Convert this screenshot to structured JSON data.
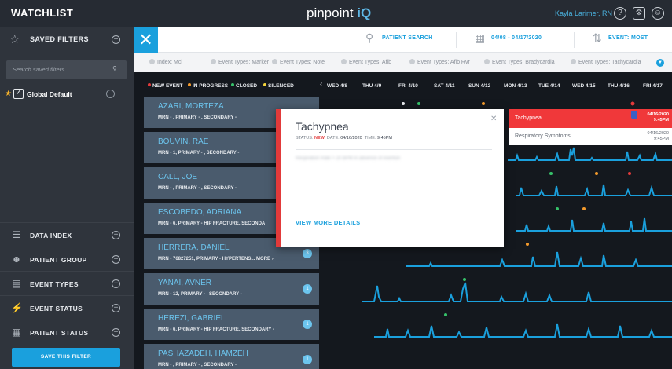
{
  "app": {
    "title": "WATCHLIST",
    "logo_text": "pinpoint",
    "logo_suffix": "iQ",
    "user_name": "Kayla Larimer, RN",
    "icons": [
      "help-icon",
      "settings-icon",
      "account-icon"
    ]
  },
  "sidebar": {
    "saved_filters_label": "SAVED FILTERS",
    "search_placeholder": "Search saved filters...",
    "global_default_label": "Global Default",
    "items": [
      {
        "label": "DATA INDEX",
        "icon": "sliders-icon"
      },
      {
        "label": "PATIENT GROUP",
        "icon": "group-icon"
      },
      {
        "label": "EVENT TYPES",
        "icon": "document-icon"
      },
      {
        "label": "EVENT STATUS",
        "icon": "status-icon"
      },
      {
        "label": "PATIENT STATUS",
        "icon": "clipboard-icon"
      }
    ],
    "save_button": "SAVE THIS FILTER"
  },
  "toolbar": {
    "patient_search": "PATIENT SEARCH",
    "date_range": "04/08 - 04/17/2020",
    "event_sort": "EVENT: MOST"
  },
  "filters": [
    "Index: Mci",
    "Event Types: Marker",
    "Event Types: Note",
    "Event Types: Afib",
    "Event Types: Afib Rvr",
    "Event Types: Bradycardia",
    "Event Types: Tachycardia"
  ],
  "legend": [
    {
      "label": "NEW EVENT",
      "color": "#e23a3a"
    },
    {
      "label": "IN PROGRESS",
      "color": "#f39a2c"
    },
    {
      "label": "CLOSED",
      "color": "#36c26a"
    },
    {
      "label": "SILENCED",
      "color": "#f3d33a"
    }
  ],
  "dates": [
    "WED 4/8",
    "THU 4/9",
    "FRI 4/10",
    "SAT 4/11",
    "SUN 4/12",
    "MON 4/13",
    "TUE 4/14",
    "WED 4/15",
    "THU 4/16",
    "FRI 4/17"
  ],
  "patients": [
    {
      "name": "AZARI, MORTEZA",
      "info": "MRN - , PRIMARY - , SECONDARY -",
      "badge": ""
    },
    {
      "name": "BOUVIN, RAE",
      "info": "MRN - 1, PRIMARY - , SECONDARY -",
      "badge": ""
    },
    {
      "name": "CALL, JOE",
      "info": "MRN - , PRIMARY - , SECONDARY -",
      "badge": ""
    },
    {
      "name": "ESCOBEDO, ADRIANA",
      "info": "MRN - 6, PRIMARY - HIP FRACTURE, SECONDA",
      "badge": ""
    },
    {
      "name": "HERRERA, DANIEL",
      "info": "MRN - 76827251, PRIMARY - HYPERTENS... MORE ›",
      "badge": "3"
    },
    {
      "name": "YANAI, AVNER",
      "info": "MRN - 12, PRIMARY - , SECONDARY -",
      "badge": "1"
    },
    {
      "name": "HEREZI, GABRIEL",
      "info": "MRN - 6, PRIMARY - HIP FRACTURE, SECONDARY -",
      "badge": "1"
    },
    {
      "name": "PASHAZADEH, HAMZEH",
      "info": "MRN - , PRIMARY - , SECONDARY -",
      "badge": "1"
    }
  ],
  "modal": {
    "title": "Tachypnea",
    "status_label": "STATUS:",
    "status_value": "NEW",
    "date_label": "DATE:",
    "date_value": "04/16/2020",
    "time_label": "TIME:",
    "time_value": "9:45PM",
    "detail_blurred": "Respiration Rate > 20 BPM in absence of exertion",
    "view_more": "VIEW MORE DETAILS"
  },
  "popover": [
    {
      "label": "Tachypnea",
      "date": "04/16/2020",
      "time": "9:45PM"
    },
    {
      "label": "Respiratory Symptoms",
      "date": "04/16/2020",
      "time": "9:45PM"
    }
  ]
}
